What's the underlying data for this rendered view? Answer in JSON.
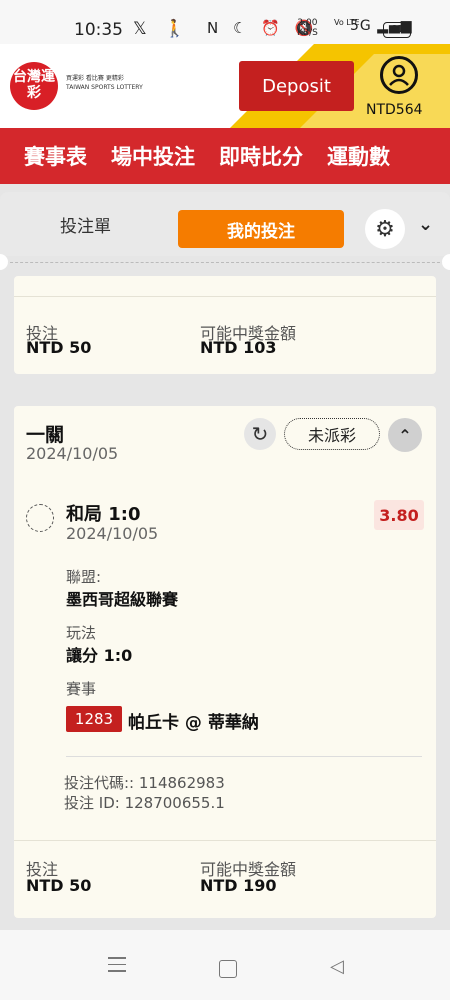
{
  "status_bar": {
    "time": "10:35",
    "left_icons": "𝕏 🚶",
    "right_icons": "N ☾ ⏰ 🔇",
    "net_speed": "2.00",
    "net_unit": "KB/S",
    "lte": "Vo LTE",
    "signal": "5G ▂▄▆",
    "battery": "61"
  },
  "header": {
    "logo_mark": "台灣運彩",
    "logo_text_1": "買運彩 看比賽 更精彩",
    "logo_text_2": "TAIWAN SPORTS LOTTERY",
    "deposit_label": "Deposit",
    "balance": "NTD564"
  },
  "nav": {
    "items": [
      "賽事表",
      "場中投注",
      "即時比分",
      "運動數"
    ]
  },
  "tabs": {
    "bet_slip": "投注單",
    "my_bets": "我的投注"
  },
  "card1": {
    "stake_label": "投注",
    "stake_value": "NTD 50",
    "payout_label": "可能中獎金額",
    "payout_value": "NTD 103"
  },
  "card2": {
    "bet_type": "一關",
    "date": "2024/10/05",
    "status": "未派彩",
    "selection": {
      "name": "和局 1:0",
      "date": "2024/10/05",
      "odds": "3.80"
    },
    "league_label": "聯盟:",
    "league_value": "墨西哥超級聯賽",
    "market_label": "玩法",
    "market_value": "讓分 1:0",
    "event_label": "賽事",
    "event_id": "1283",
    "event_name": "帕丘卡 @ 蒂華納",
    "bet_code": "投注代碼:: 114862983",
    "bet_id": "投注 ID: 128700655.1",
    "stake_label": "投注",
    "stake_value": "NTD 50",
    "payout_label": "可能中獎金額",
    "payout_value": "NTD 190"
  },
  "colors": {
    "brand_red": "#d4282c",
    "accent_orange": "#f57c00",
    "yellow": "#f5c400"
  }
}
